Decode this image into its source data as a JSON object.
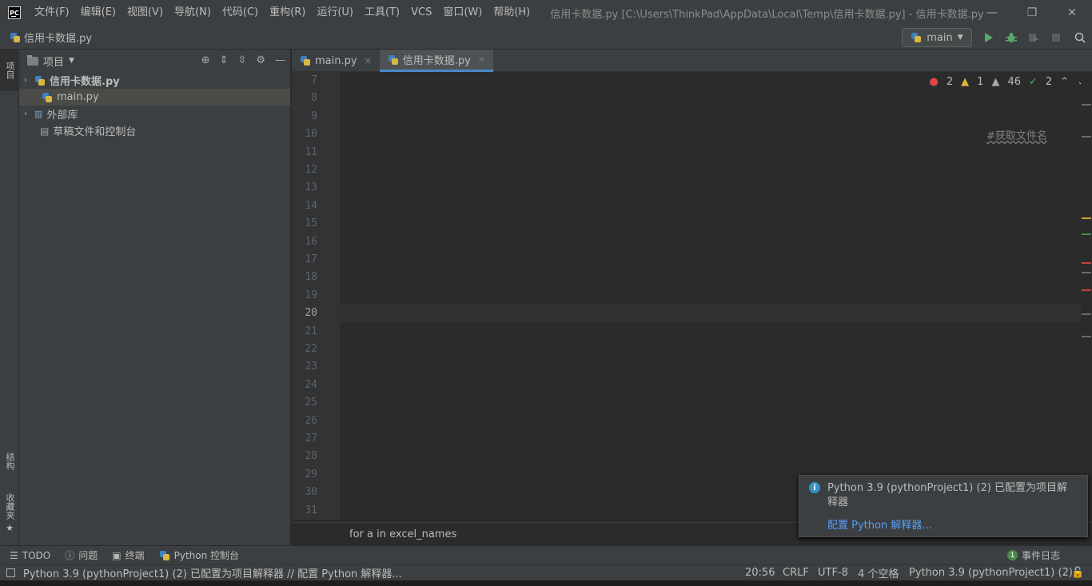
{
  "window": {
    "title": "信用卡数据.py [C:\\Users\\ThinkPad\\AppData\\Local\\Temp\\信用卡数据.py] - 信用卡数据.py",
    "logo_text": "PC",
    "menu": [
      "文件(F)",
      "编辑(E)",
      "视图(V)",
      "导航(N)",
      "代码(C)",
      "重构(R)",
      "运行(U)",
      "工具(T)",
      "VCS",
      "窗口(W)",
      "帮助(H)"
    ],
    "controls": {
      "minimize": "—",
      "restore": "❐",
      "close": "✕"
    }
  },
  "navbar": {
    "file": "信用卡数据.py",
    "run_config": "main"
  },
  "left_strip": {
    "project": "项目",
    "structure": "结构",
    "favorites": "收藏夹"
  },
  "project_panel": {
    "title": "项目",
    "tree": [
      {
        "label": "信用卡数据.py",
        "bold": true
      },
      {
        "label": "main.py"
      },
      {
        "label": "外部库"
      },
      {
        "label": "草稿文件和控制台"
      }
    ]
  },
  "tabs": [
    {
      "label": "main.py",
      "active": false
    },
    {
      "label": "信用卡数据.py",
      "active": true
    }
  ],
  "inspections": {
    "errors": "2",
    "warnings": "1",
    "weak": "46",
    "typos": "2"
  },
  "code": {
    "line_numbers": [
      "7",
      "8",
      "9",
      "10",
      "11",
      "12",
      "13",
      "14",
      "15",
      "16",
      "17",
      "18",
      "19",
      "20",
      "21",
      "22",
      "23",
      "24",
      "25",
      "26",
      "27",
      "28",
      "29",
      "30",
      "31"
    ],
    "current_line": "20",
    "right_comment": "#获取文件名"
  },
  "breadcrumb": "for a in excel_names",
  "notification": {
    "icon": "i",
    "message": "Python 3.9 (pythonProject1) (2) 已配置为项目解释器",
    "link": "配置 Python 解释器..."
  },
  "tool_windows": [
    "TODO",
    "问题",
    "终端",
    "Python 控制台"
  ],
  "event_log": {
    "count": "1",
    "label": "事件日志"
  },
  "status": {
    "message": "Python 3.9 (pythonProject1) (2) 已配置为项目解释器 // 配置 Python 解释器...",
    "position": "20:56",
    "line_sep": "CRLF",
    "encoding": "UTF-8",
    "indent": "4 个空格",
    "interpreter": "Python 3.9 (pythonProject1) (2)"
  }
}
